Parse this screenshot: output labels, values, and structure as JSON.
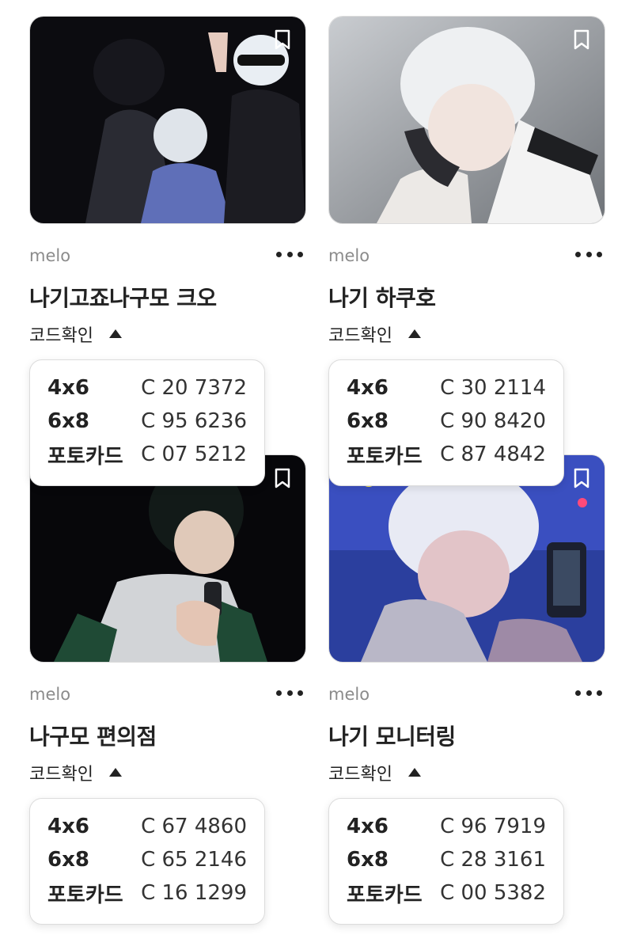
{
  "cards": [
    {
      "author": "melo",
      "title": "나기고죠나구모 크오",
      "code_toggle": "코드확인",
      "codes": [
        {
          "size": "4x6",
          "code": "C 20 7372"
        },
        {
          "size": "6x8",
          "code": "C 95 6236"
        },
        {
          "size": "포토카드",
          "code": "C 07 5212"
        }
      ]
    },
    {
      "author": "melo",
      "title": "나기 하쿠호",
      "code_toggle": "코드확인",
      "codes": [
        {
          "size": "4x6",
          "code": "C 30 2114"
        },
        {
          "size": "6x8",
          "code": "C 90 8420"
        },
        {
          "size": "포토카드",
          "code": "C 87 4842"
        }
      ]
    },
    {
      "author": "melo",
      "title": "나구모 편의점",
      "code_toggle": "코드확인",
      "codes": [
        {
          "size": "4x6",
          "code": "C 67 4860"
        },
        {
          "size": "6x8",
          "code": "C 65 2146"
        },
        {
          "size": "포토카드",
          "code": "C 16 1299"
        }
      ]
    },
    {
      "author": "melo",
      "title": "나기 모니터링",
      "code_toggle": "코드확인",
      "codes": [
        {
          "size": "4x6",
          "code": "C 96 7919"
        },
        {
          "size": "6x8",
          "code": "C 28 3161"
        },
        {
          "size": "포토카드",
          "code": "C 00 5382"
        }
      ]
    }
  ],
  "colors": {
    "accent_text": "#222222",
    "muted_text": "#8b8b8b",
    "card_border": "#dcdcdc"
  },
  "icons": [
    "bookmark-icon",
    "more-options-icon",
    "caret-up-icon"
  ]
}
